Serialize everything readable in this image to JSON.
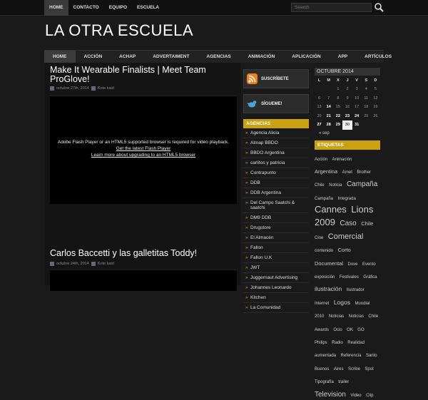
{
  "topnav": [
    "HOME",
    "CONTACTO",
    "EQUIPO",
    "ESCUELA"
  ],
  "search_placeholder": "Search",
  "site_title": "LA OTRA ESCUELA",
  "mainnav": [
    "HOME",
    "ACCIÓN",
    "ACHAP",
    "ADVERTAIMENT",
    "AGENCIAS",
    "ANIMACIÓN",
    "APLICACIÓN",
    "APP",
    "ARTÍCULOS"
  ],
  "posts": [
    {
      "title": "Make It Wearable Finalists | Meet Team ProGlove!",
      "date": "octubre 27th, 2014",
      "author": "Kote kaid"
    },
    {
      "title": "Carlos Baccetti y las galletitas Toddy!",
      "date": "octubre 24th, 2014",
      "author": "Kote kaid"
    }
  ],
  "flash": {
    "line1": "Adobe Flash Player or an HTML5 supported browser is required for video playback.",
    "line2": "Get the latest Flash Player",
    "line3": "Learn more about upgrading to an HTML5 browser"
  },
  "sidebar1": {
    "subscribe": "SUSCRÍBETE",
    "follow": "SÍGUEME!",
    "agencias_title": "AGENCIAS",
    "agencias": [
      "Agencia Alicia",
      "Almap BBDO",
      "BBDO Argentina",
      "carlitos y patricia",
      "Contrapunto",
      "DDB",
      "DDB Argentina",
      "Del Campo Saatchi & saatchi",
      "DM9 DDB",
      "Drugstore",
      "El Almacén",
      "Fallon",
      "Fallon U.K",
      "JWT",
      "Juggernaut Advertising",
      "Johannes Leonardo",
      "Kitchen",
      "La Comunidad"
    ]
  },
  "calendar": {
    "title": "OCTUBRE 2014",
    "weekdays": [
      "L",
      "M",
      "X",
      "J",
      "V",
      "S",
      "D"
    ],
    "rows": [
      [
        "",
        "",
        "1",
        "2",
        "3",
        "4",
        "5"
      ],
      [
        "6",
        "7",
        "8",
        "9",
        "10",
        "11",
        "12"
      ],
      [
        "13",
        "14",
        "15",
        "16",
        "17",
        "18",
        "19"
      ],
      [
        "20",
        "21",
        "22",
        "23",
        "24",
        "25",
        "26"
      ],
      [
        "27",
        "28",
        "29",
        "30",
        "31",
        "",
        ""
      ]
    ],
    "bold": [
      "14",
      "21",
      "22",
      "23",
      "24",
      "27",
      "28",
      "29",
      "30",
      "31"
    ],
    "today": "30",
    "prev": "« sep"
  },
  "etiquetas_title": "ETIQUETAS",
  "tags": [
    {
      "t": "Acción",
      "s": 6
    },
    {
      "t": "Animación",
      "s": 6
    },
    {
      "t": "Argentina",
      "s": 7.5
    },
    {
      "t": "Arnet",
      "s": 6
    },
    {
      "t": "Brother",
      "s": 6
    },
    {
      "t": "Chile",
      "s": 6
    },
    {
      "t": "Noticia",
      "s": 6
    },
    {
      "t": "Campaña",
      "s": 10
    },
    {
      "t": "Campaña",
      "s": 6
    },
    {
      "t": "Integrada",
      "s": 6
    },
    {
      "t": "Cannes",
      "s": 13
    },
    {
      "t": "Lions",
      "s": 13
    },
    {
      "t": "2009",
      "s": 13
    },
    {
      "t": "Caso",
      "s": 10
    },
    {
      "t": "Chile",
      "s": 7.5
    },
    {
      "t": "Cine",
      "s": 6
    },
    {
      "t": "Comercial",
      "s": 11
    },
    {
      "t": "contenido",
      "s": 6
    },
    {
      "t": "Corto",
      "s": 7.5
    },
    {
      "t": "Documental",
      "s": 7.5
    },
    {
      "t": "Dove",
      "s": 6
    },
    {
      "t": "Evento",
      "s": 6
    },
    {
      "t": "exposición",
      "s": 6
    },
    {
      "t": "Festivales",
      "s": 6
    },
    {
      "t": "Gráfica",
      "s": 6
    },
    {
      "t": "ilustración",
      "s": 8.5
    },
    {
      "t": "Ilustrador",
      "s": 6
    },
    {
      "t": "Internet",
      "s": 6
    },
    {
      "t": "Logos",
      "s": 8.5
    },
    {
      "t": "Mundial",
      "s": 6
    },
    {
      "t": "2010",
      "s": 6
    },
    {
      "t": "Noticias",
      "s": 6
    },
    {
      "t": "Noticias",
      "s": 6
    },
    {
      "t": "Chile",
      "s": 6
    },
    {
      "t": "Awards",
      "s": 6
    },
    {
      "t": "Ocio",
      "s": 6
    },
    {
      "t": "OK",
      "s": 6
    },
    {
      "t": "GO",
      "s": 6
    },
    {
      "t": "Philips",
      "s": 6
    },
    {
      "t": "Radio",
      "s": 6
    },
    {
      "t": "Realidad",
      "s": 6
    },
    {
      "t": "aumentada",
      "s": 6
    },
    {
      "t": "Referencia",
      "s": 6
    },
    {
      "t": "Santo",
      "s": 6
    },
    {
      "t": "Buenos",
      "s": 6
    },
    {
      "t": "Aires",
      "s": 6
    },
    {
      "t": "Scribe",
      "s": 6
    },
    {
      "t": "Spot",
      "s": 6
    },
    {
      "t": "Tipografía",
      "s": 6
    },
    {
      "t": "trailer",
      "s": 6
    },
    {
      "t": "Television",
      "s": 10
    },
    {
      "t": "Video",
      "s": 6
    },
    {
      "t": "Clip",
      "s": 6
    }
  ],
  "colors": {
    "accent": "#c9a213",
    "bg": "#1a1a1a"
  }
}
